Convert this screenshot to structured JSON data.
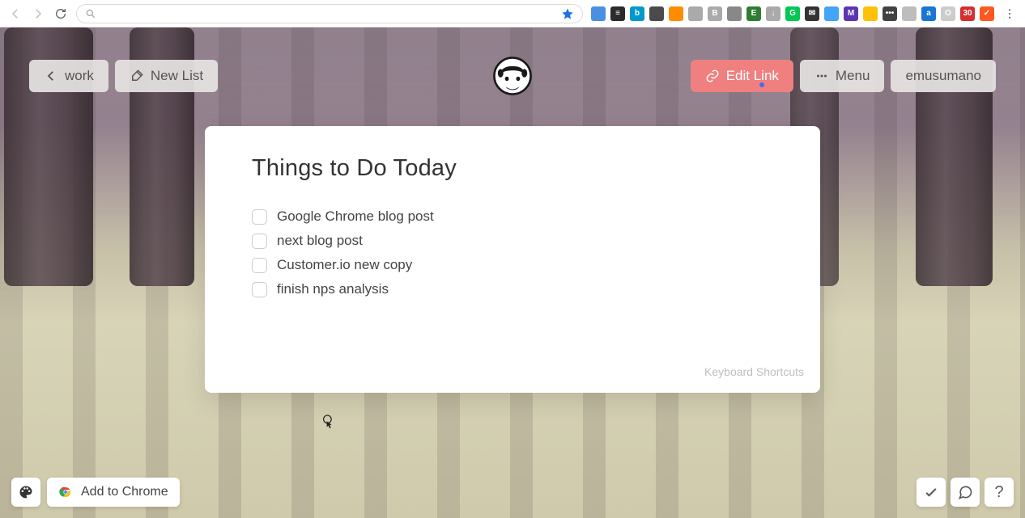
{
  "browser": {
    "url": "",
    "extensions": [
      {
        "bg": "#4a90e2",
        "label": "",
        "name": "lastpass"
      },
      {
        "bg": "#2b2b2b",
        "label": "≡",
        "name": "buffer"
      },
      {
        "bg": "#0099cc",
        "label": "b",
        "name": "bitly"
      },
      {
        "bg": "#4a4a4a",
        "label": "",
        "name": "brush"
      },
      {
        "bg": "#ff8c00",
        "label": "",
        "name": "carrot"
      },
      {
        "bg": "#aaaaaa",
        "label": "",
        "name": "edit"
      },
      {
        "bg": "#aaaaaa",
        "label": "B",
        "name": "bold"
      },
      {
        "bg": "#888888",
        "label": "",
        "name": "square"
      },
      {
        "bg": "#2e7d32",
        "label": "E",
        "name": "evernote"
      },
      {
        "bg": "#aaaaaa",
        "label": "↓",
        "name": "download"
      },
      {
        "bg": "#00c853",
        "label": "G",
        "name": "grammarly"
      },
      {
        "bg": "#333333",
        "label": "✉",
        "name": "mail"
      },
      {
        "bg": "#42a5f5",
        "label": "",
        "name": "skype"
      },
      {
        "bg": "#5e35b1",
        "label": "M",
        "name": "mega"
      },
      {
        "bg": "#ffc107",
        "label": "",
        "name": "honey"
      },
      {
        "bg": "#424242",
        "label": "•••",
        "name": "onepass"
      },
      {
        "bg": "#bdbdbd",
        "label": "",
        "name": "grey"
      },
      {
        "bg": "#1976d2",
        "label": "a",
        "name": "alexa"
      },
      {
        "bg": "#cccccc",
        "label": "O",
        "name": "circle"
      },
      {
        "bg": "#d32f2f",
        "label": "30",
        "name": "calendar"
      },
      {
        "bg": "#ff5722",
        "label": "✓",
        "name": "todoist"
      }
    ]
  },
  "header": {
    "back_label": "work",
    "new_list_label": "New List",
    "edit_link_label": "Edit Link",
    "menu_label": "Menu",
    "username": "emusumano"
  },
  "card": {
    "title": "Things to Do Today",
    "items": [
      {
        "text": "Google Chrome blog post",
        "done": false
      },
      {
        "text": "next blog post",
        "done": false
      },
      {
        "text": "Customer.io new copy",
        "done": false
      },
      {
        "text": "finish nps analysis",
        "done": false
      }
    ],
    "shortcuts_label": "Keyboard Shortcuts"
  },
  "bottom": {
    "add_chrome_label": "Add to Chrome",
    "help_label": "?"
  }
}
